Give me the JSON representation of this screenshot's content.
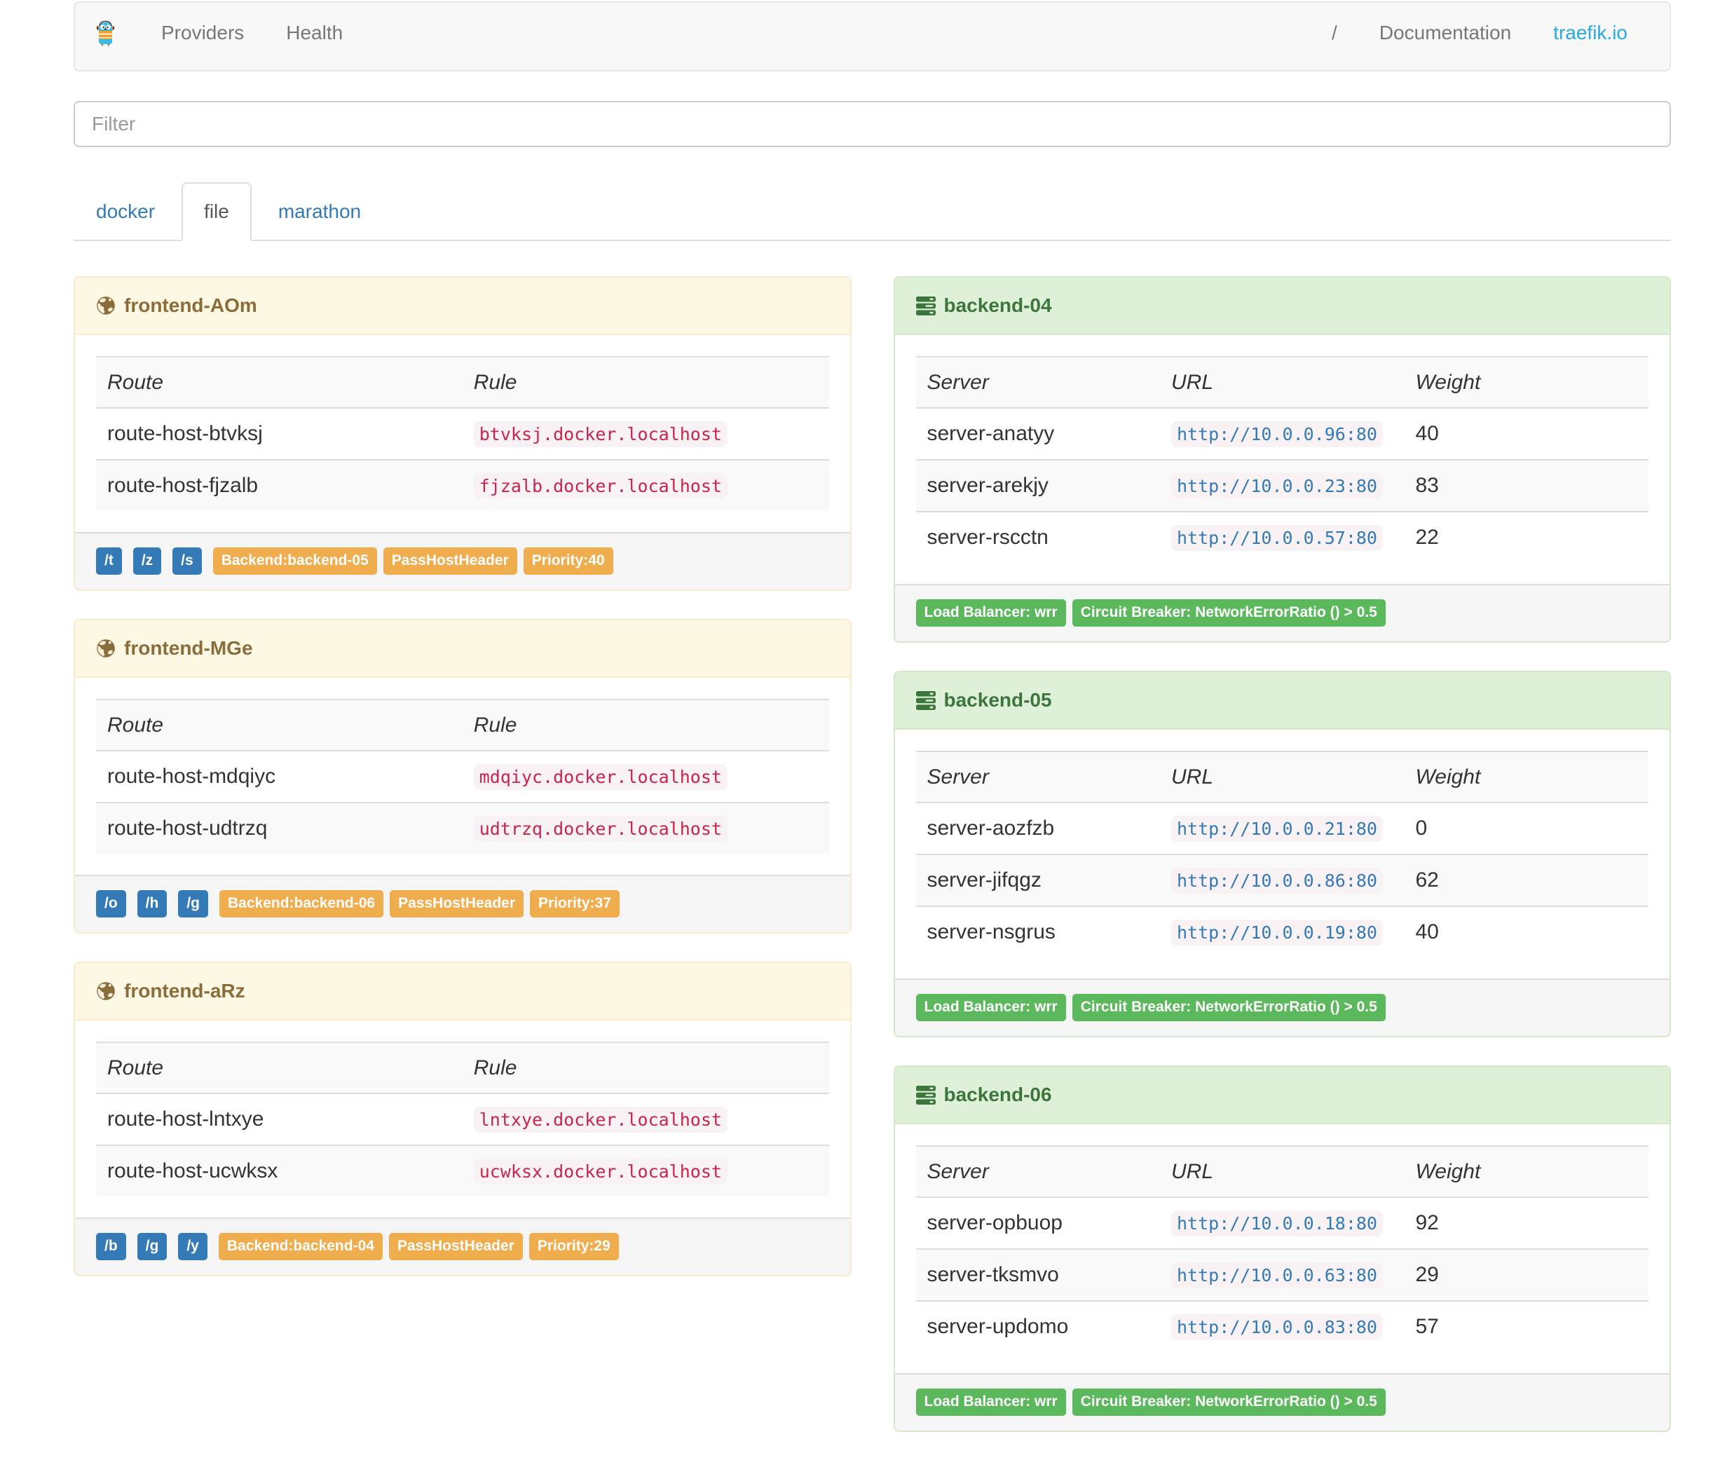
{
  "nav": {
    "brand": "traefik-logo",
    "items": [
      {
        "label": "Providers"
      },
      {
        "label": "Health"
      }
    ],
    "right_items": [
      {
        "label": "/"
      },
      {
        "label": "Documentation"
      },
      {
        "label": "traefik.io"
      }
    ]
  },
  "filter": {
    "placeholder": "Filter",
    "value": ""
  },
  "tabs": [
    {
      "label": "docker",
      "active": false
    },
    {
      "label": "file",
      "active": true
    },
    {
      "label": "marathon",
      "active": false
    }
  ],
  "frontend_columns": {
    "route": "Route",
    "rule": "Rule"
  },
  "backend_columns": {
    "server": "Server",
    "url": "URL",
    "weight": "Weight"
  },
  "frontends": [
    {
      "title": "frontend-AOm",
      "rows": [
        {
          "route": "route-host-btvksj",
          "rule": "btvksj.docker.localhost"
        },
        {
          "route": "route-host-fjzalb",
          "rule": "fjzalb.docker.localhost"
        }
      ],
      "entry_tags": [
        "/t",
        "/z",
        "/s"
      ],
      "detail_tags": [
        "Backend:backend-05",
        "PassHostHeader",
        "Priority:40"
      ]
    },
    {
      "title": "frontend-MGe",
      "rows": [
        {
          "route": "route-host-mdqiyc",
          "rule": "mdqiyc.docker.localhost"
        },
        {
          "route": "route-host-udtrzq",
          "rule": "udtrzq.docker.localhost"
        }
      ],
      "entry_tags": [
        "/o",
        "/h",
        "/g"
      ],
      "detail_tags": [
        "Backend:backend-06",
        "PassHostHeader",
        "Priority:37"
      ]
    },
    {
      "title": "frontend-aRz",
      "rows": [
        {
          "route": "route-host-lntxye",
          "rule": "lntxye.docker.localhost"
        },
        {
          "route": "route-host-ucwksx",
          "rule": "ucwksx.docker.localhost"
        }
      ],
      "entry_tags": [
        "/b",
        "/g",
        "/y"
      ],
      "detail_tags": [
        "Backend:backend-04",
        "PassHostHeader",
        "Priority:29"
      ]
    }
  ],
  "backends": [
    {
      "title": "backend-04",
      "rows": [
        {
          "server": "server-anatyy",
          "url": "http://10.0.0.96:80",
          "weight": "40"
        },
        {
          "server": "server-arekjy",
          "url": "http://10.0.0.23:80",
          "weight": "83"
        },
        {
          "server": "server-rscctn",
          "url": "http://10.0.0.57:80",
          "weight": "22"
        }
      ],
      "tags": [
        "Load Balancer: wrr",
        "Circuit Breaker: NetworkErrorRatio () > 0.5"
      ]
    },
    {
      "title": "backend-05",
      "rows": [
        {
          "server": "server-aozfzb",
          "url": "http://10.0.0.21:80",
          "weight": "0"
        },
        {
          "server": "server-jifqgz",
          "url": "http://10.0.0.86:80",
          "weight": "62"
        },
        {
          "server": "server-nsgrus",
          "url": "http://10.0.0.19:80",
          "weight": "40"
        }
      ],
      "tags": [
        "Load Balancer: wrr",
        "Circuit Breaker: NetworkErrorRatio () > 0.5"
      ]
    },
    {
      "title": "backend-06",
      "rows": [
        {
          "server": "server-opbuop",
          "url": "http://10.0.0.18:80",
          "weight": "92"
        },
        {
          "server": "server-tksmvo",
          "url": "http://10.0.0.63:80",
          "weight": "29"
        },
        {
          "server": "server-updomo",
          "url": "http://10.0.0.83:80",
          "weight": "57"
        }
      ],
      "tags": [
        "Load Balancer: wrr",
        "Circuit Breaker: NetworkErrorRatio () > 0.5"
      ]
    }
  ],
  "colors": {
    "navbar_bg": "#f8f8f8",
    "link": "#337ab7",
    "traefik_blue": "#2AA9E0",
    "warning_bg": "#fcf8e3",
    "warning_border": "#faebcc",
    "warning_text": "#8a6d3b",
    "success_bg": "#dff0d8",
    "success_border": "#d6e9c6",
    "success_text": "#3c763d",
    "label_primary": "#337ab7",
    "label_warning": "#f0ad4e",
    "label_success": "#5cb85c",
    "code_text": "#c7254e",
    "code_bg": "#f9f2f4"
  }
}
